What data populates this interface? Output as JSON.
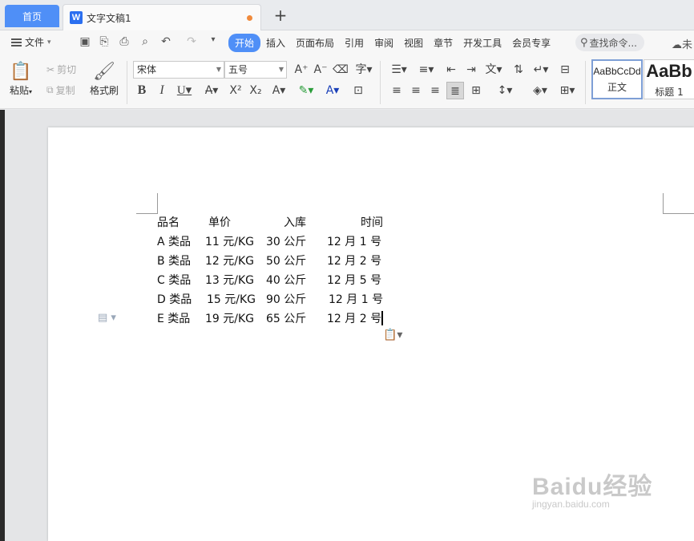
{
  "tabs": {
    "home": "首页",
    "document": {
      "icon": "W",
      "title": "文字文稿1"
    },
    "new_tab": "+"
  },
  "menu": {
    "file": "文件",
    "tabs": [
      "开始",
      "插入",
      "页面布局",
      "引用",
      "审阅",
      "视图",
      "章节",
      "开发工具",
      "会员专享"
    ],
    "active_tab": "开始",
    "search": "查找命令...",
    "cloud_partial": "未"
  },
  "ribbon": {
    "paste": "粘贴",
    "cut": "剪切",
    "copy": "复制",
    "format_painter": "格式刷",
    "font_name": "宋体",
    "font_size": "五号",
    "styles": [
      {
        "preview": "AaBbCcDd",
        "name": "正文"
      },
      {
        "preview": "AaBb",
        "name": "标题 1"
      }
    ]
  },
  "document": {
    "headers": [
      "品名",
      "单价",
      "入库",
      "时间"
    ],
    "rows": [
      [
        "A 类品",
        "11 元/KG",
        "30 公斤",
        "12 月 1 号"
      ],
      [
        "B 类品",
        "12 元/KG",
        "50 公斤",
        "12 月 2 号"
      ],
      [
        "C 类品",
        "13 元/KG",
        "40 公斤",
        "12 月 5 号"
      ],
      [
        "D 类品",
        "15 元/KG",
        "90 公斤",
        "12 月 1 号"
      ],
      [
        "E 类品",
        "19 元/KG",
        "65 公斤",
        "12 月 2 号"
      ]
    ]
  },
  "watermark": {
    "brand": "Baidu经验",
    "url": "jingyan.baidu.com"
  },
  "colors": {
    "accent": "#4f8ff7",
    "unsaved": "#f08a3c"
  }
}
